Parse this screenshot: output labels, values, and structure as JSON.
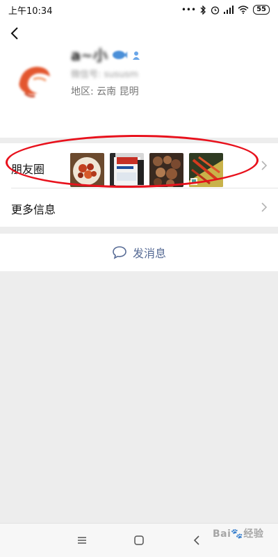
{
  "status_bar": {
    "time": "上午10:34",
    "signal_dots": "•••",
    "battery": "55"
  },
  "profile": {
    "name": "a~小",
    "wechat_id": "微信号: sususm",
    "region": "地区:  云南  昆明"
  },
  "moments": {
    "label": "朋友圈",
    "thumbnails": [
      "food-photo-1",
      "product-box-photo",
      "food-photo-2",
      "food-photo-3"
    ]
  },
  "more_info": {
    "label": "更多信息"
  },
  "send_message": {
    "label": "发消息"
  },
  "colors": {
    "link": "#576b95",
    "annotation": "#e8111c",
    "background": "#ededed"
  },
  "watermark": {
    "text": "Bai",
    "text2": "经验"
  }
}
